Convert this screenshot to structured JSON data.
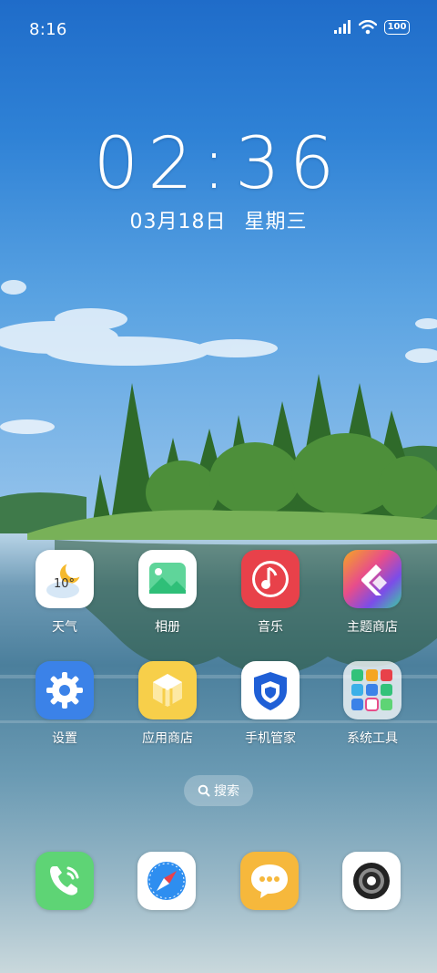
{
  "status_bar": {
    "time": "8:16",
    "battery": "100"
  },
  "clock": {
    "time": "02:36",
    "date": "03月18日",
    "weekday": "星期三"
  },
  "weather_widget_temp": "10°",
  "apps": [
    {
      "label": "天气",
      "icon": "weather-icon"
    },
    {
      "label": "相册",
      "icon": "gallery-icon"
    },
    {
      "label": "音乐",
      "icon": "music-icon"
    },
    {
      "label": "主题商店",
      "icon": "theme-store-icon"
    },
    {
      "label": "设置",
      "icon": "settings-icon"
    },
    {
      "label": "应用商店",
      "icon": "app-store-icon"
    },
    {
      "label": "手机管家",
      "icon": "phone-manager-icon"
    },
    {
      "label": "系统工具",
      "icon": "system-tools-folder-icon"
    }
  ],
  "search": {
    "label": "搜索"
  },
  "dock": [
    {
      "icon": "phone-icon"
    },
    {
      "icon": "browser-icon"
    },
    {
      "icon": "messages-icon"
    },
    {
      "icon": "camera-icon"
    }
  ],
  "colors": {
    "music": "#e8414a",
    "settings": "#3b82e8",
    "app_store": "#f7cf4a",
    "phone": "#5ed475",
    "messages": "#f6b83c"
  }
}
